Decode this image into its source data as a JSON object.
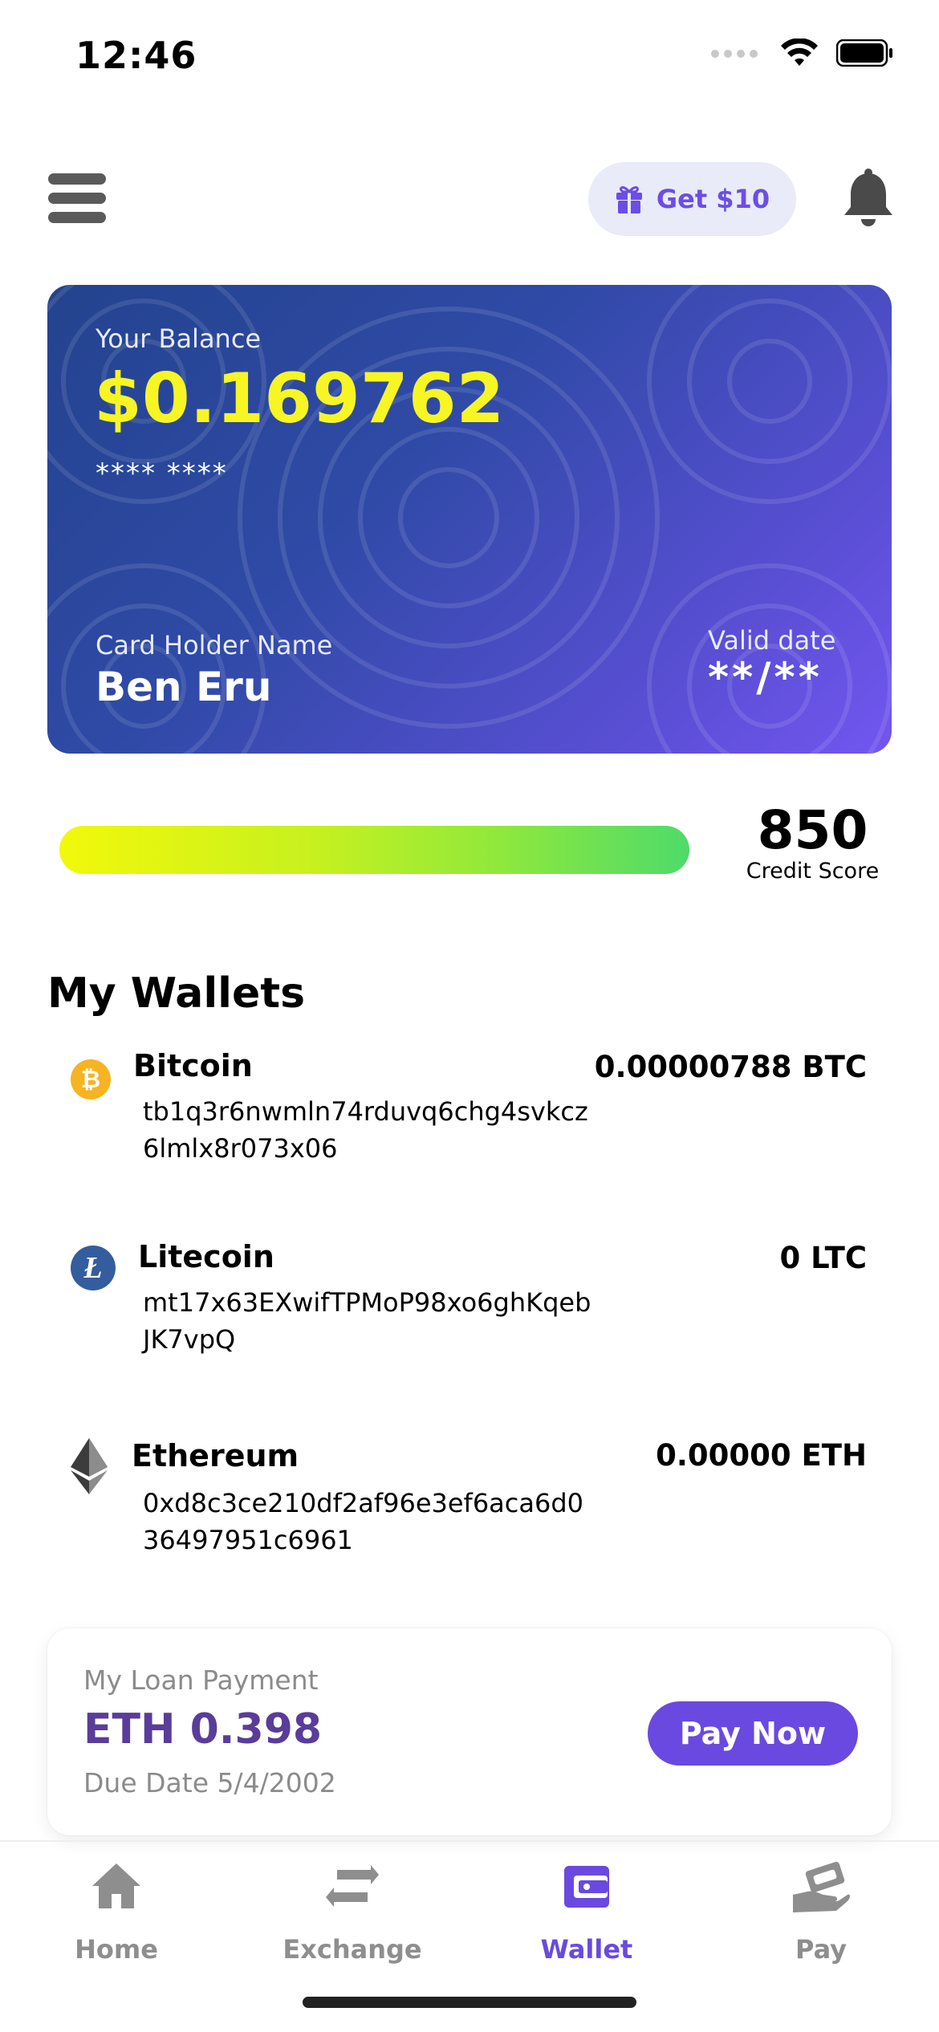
{
  "status_bar": {
    "time": "12:46"
  },
  "header": {
    "promo_label": "Get $10"
  },
  "card": {
    "balance_label": "Your Balance",
    "balance": "$0.169762",
    "masked_number": "**** ****",
    "holder_label": "Card Holder Name",
    "holder_name": "Ben Eru",
    "valid_label": "Valid date",
    "valid_value": "**/**"
  },
  "credit": {
    "score": "850",
    "label": "Credit Score"
  },
  "wallets": {
    "title": "My Wallets",
    "items": [
      {
        "name": "Bitcoin",
        "address": "tb1q3r6nwmln74rduvq6chg4svkcz6lmlx8r073x06",
        "amount": "0.00000788 BTC",
        "icon": "bitcoin-icon"
      },
      {
        "name": "Litecoin",
        "address": "mt17x63EXwifTPMoP98xo6ghKqebJK7vpQ",
        "amount": "0 LTC",
        "icon": "litecoin-icon"
      },
      {
        "name": "Ethereum",
        "address": "0xd8c3ce210df2af96e3ef6aca6d036497951c6961",
        "amount": "0.00000 ETH",
        "icon": "ethereum-icon"
      }
    ]
  },
  "loan": {
    "label": "My Loan Payment",
    "amount": "ETH 0.398",
    "due": "Due Date 5/4/2002",
    "pay_label": "Pay Now"
  },
  "nav": {
    "items": [
      {
        "label": "Home",
        "icon": "home-icon"
      },
      {
        "label": "Exchange",
        "icon": "exchange-icon"
      },
      {
        "label": "Wallet",
        "icon": "wallet-icon",
        "active": true
      },
      {
        "label": "Pay",
        "icon": "pay-icon"
      }
    ]
  },
  "colors": {
    "accent": "#6a49e0",
    "balance": "#f8f524",
    "loan_amount": "#5a3c9a"
  }
}
